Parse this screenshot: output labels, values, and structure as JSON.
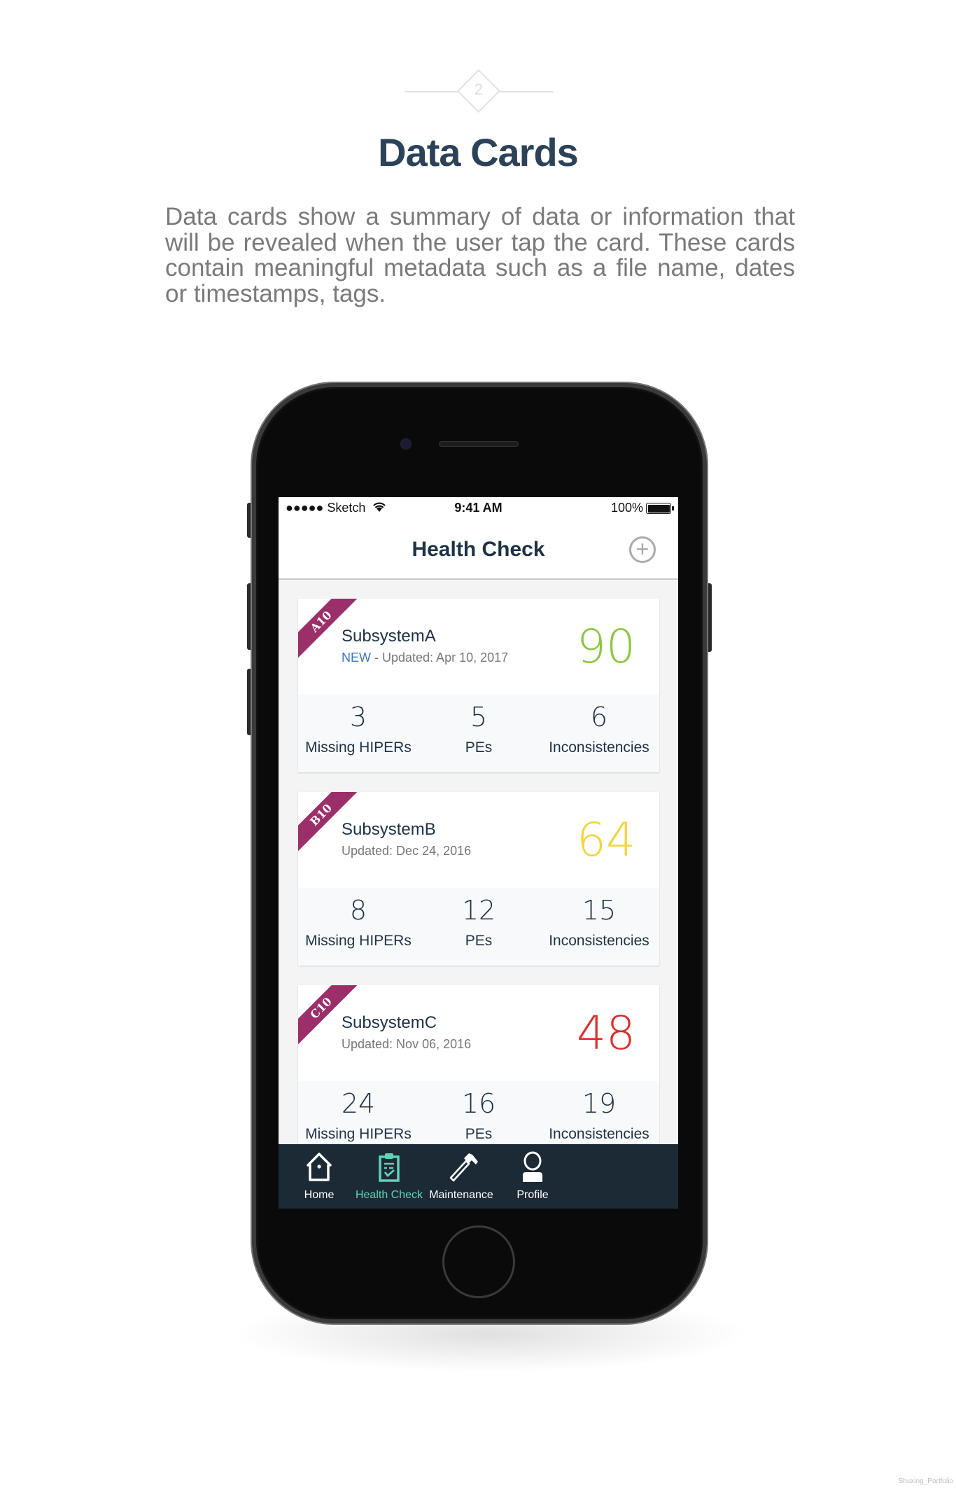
{
  "section": {
    "number": "2",
    "title": "Data Cards",
    "description": "Data cards show a summary of data or information that will be revealed when the user tap the card. These cards contain meaningful metadata such as a file name, dates or timestamps, tags."
  },
  "status_bar": {
    "carrier": "●●●●● Sketch",
    "time": "9:41 AM",
    "battery": "100%"
  },
  "nav": {
    "title": "Health Check",
    "add_icon": "plus-circle-icon"
  },
  "cards": [
    {
      "tag": "A10",
      "name": "SubsystemA",
      "new_label": "NEW",
      "updated": " - Updated: Apr 10, 2017",
      "score": "90",
      "score_color": "#8cc63f",
      "stats": [
        {
          "value": "3",
          "label": "Missing HIPERs"
        },
        {
          "value": "5",
          "label": "PEs"
        },
        {
          "value": "6",
          "label": "Inconsistencies"
        }
      ]
    },
    {
      "tag": "B10",
      "name": "SubsystemB",
      "updated": "Updated: Dec 24, 2016",
      "score": "64",
      "score_color": "#f5d33f",
      "stats": [
        {
          "value": "8",
          "label": "Missing HIPERs"
        },
        {
          "value": "12",
          "label": "PEs"
        },
        {
          "value": "15",
          "label": "Inconsistencies"
        }
      ]
    },
    {
      "tag": "C10",
      "name": "SubsystemC",
      "updated": "Updated: Nov 06, 2016",
      "score": "48",
      "score_color": "#d9302c",
      "stats": [
        {
          "value": "24",
          "label": "Missing HIPERs"
        },
        {
          "value": "16",
          "label": "PEs"
        },
        {
          "value": "19",
          "label": "Inconsistencies"
        }
      ]
    }
  ],
  "tabs": [
    {
      "label": "Home",
      "icon": "home-icon"
    },
    {
      "label": "Health Check",
      "icon": "clipboard-check-icon",
      "active": true
    },
    {
      "label": "Maintenance",
      "icon": "hammer-icon"
    },
    {
      "label": "Profile",
      "icon": "user-icon"
    }
  ],
  "colors": {
    "accent": "#5fd3b8",
    "tabbar": "#1c2a35",
    "ribbon": "#9b2f6a",
    "title": "#2c4258"
  },
  "watermark": "Shuxing_Portfolio"
}
